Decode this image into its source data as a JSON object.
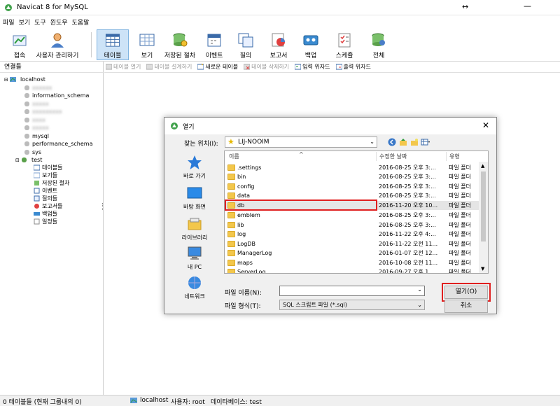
{
  "window": {
    "title": "Navicat 8 for MySQL"
  },
  "menu": [
    "파일",
    "보기",
    "도구",
    "윈도우",
    "도움말"
  ],
  "toolbar": {
    "connect": "접속",
    "user_mgmt": "사용자 관리하기",
    "tables": "테이블",
    "views": "보기",
    "procedures": "저장된 절차",
    "events": "이벤트",
    "queries": "질의",
    "reports": "보고서",
    "backup": "백업",
    "schedule": "스케쥴",
    "all": "전체"
  },
  "sidebar": {
    "header": "연결들",
    "connection": "localhost",
    "databases": [
      "information_schema",
      "mysql",
      "performance_schema",
      "sys",
      "test"
    ],
    "test_children": [
      "테이블들",
      "보기들",
      "저장된 절차",
      "이벤트",
      "질의들",
      "보고서들",
      "백업들",
      "일정들"
    ]
  },
  "objbar": {
    "open": "테이블 열기",
    "design": "테이블 설계하기",
    "new": "새로운 테이블",
    "delete": "테이블 삭제하기",
    "import": "입력 위자드",
    "export": "출력 위자드"
  },
  "dialog": {
    "title": "열기",
    "lookin_label": "찾는 위치(I):",
    "lookin_value": "LIJ-NOOIM",
    "places": [
      "바로 가기",
      "바탕 화면",
      "라이브러리",
      "내 PC",
      "네트워크"
    ],
    "columns": {
      "name": "이름",
      "date": "수정한 날짜",
      "type": "유형"
    },
    "files": [
      {
        "name": ".settings",
        "date": "2016-08-25 오후 3:...",
        "type": "파일 폴더"
      },
      {
        "name": "bin",
        "date": "2016-08-25 오후 3:...",
        "type": "파일 폴더"
      },
      {
        "name": "config",
        "date": "2016-08-25 오후 3:...",
        "type": "파일 폴더"
      },
      {
        "name": "data",
        "date": "2016-08-25 오후 3:...",
        "type": "파일 폴더"
      },
      {
        "name": "db",
        "date": "2016-11-20 오후 10...",
        "type": "파일 폴더"
      },
      {
        "name": "emblem",
        "date": "2016-08-25 오후 3:...",
        "type": "파일 폴더"
      },
      {
        "name": "lib",
        "date": "2016-08-25 오후 3:...",
        "type": "파일 폴더"
      },
      {
        "name": "log",
        "date": "2016-11-22 오후 4:...",
        "type": "파일 폴더"
      },
      {
        "name": "LogDB",
        "date": "2016-11-22 오전 11...",
        "type": "파일 폴더"
      },
      {
        "name": "ManagerLog",
        "date": "2016-01-07 오전 12...",
        "type": "파일 폴더"
      },
      {
        "name": "maps",
        "date": "2016-10-08 오전 11...",
        "type": "파일 폴더"
      },
      {
        "name": "ServerLog",
        "date": "2016-09-27 오후 1...",
        "type": "파일 폴더"
      }
    ],
    "filename_label": "파일 이름(N):",
    "filename_value": "",
    "filetype_label": "파일 형식(T):",
    "filetype_value": "SQL 스크립트 파일 (*.sql)",
    "open_button": "열기(O)",
    "cancel_button": "취소"
  },
  "status": {
    "tables": "0 테이블들 (현재 그룹내의 0)",
    "host": "localhost",
    "user": "사용자: root",
    "database": "데이타베이스: test"
  },
  "colors": {
    "highlight_red": "#e02020",
    "folder_yellow": "#f3c74c",
    "selected_tool": "#cde3f7"
  }
}
